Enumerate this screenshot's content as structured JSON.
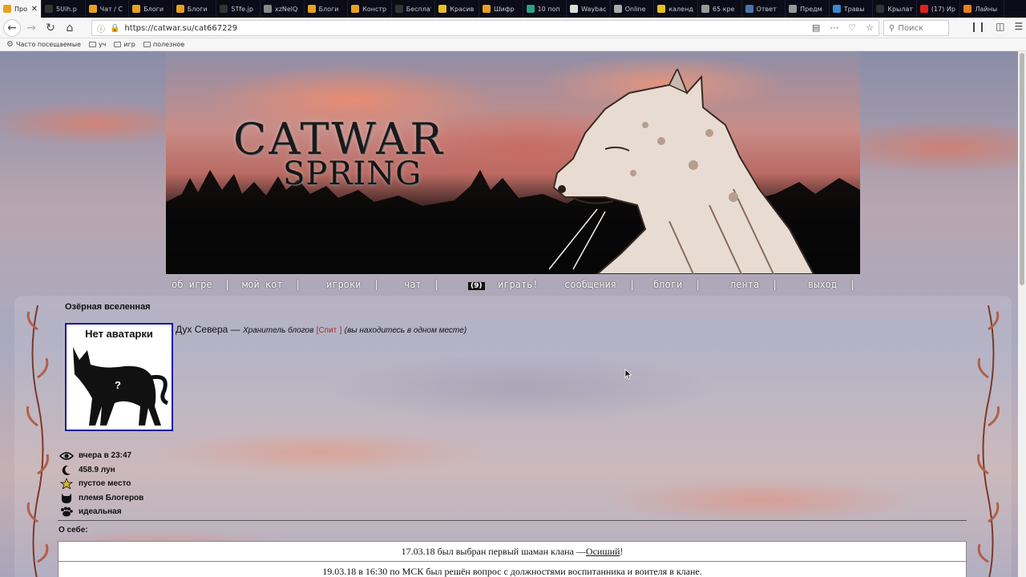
{
  "browser": {
    "tabs": [
      {
        "label": "Про",
        "color": "#e8a020",
        "active": true
      },
      {
        "label": "5Uih.p",
        "color": "#333"
      },
      {
        "label": "Чат / С",
        "color": "#e8a020"
      },
      {
        "label": "Блоги",
        "color": "#e8a020"
      },
      {
        "label": "Блоги",
        "color": "#e8a020"
      },
      {
        "label": "5Tfe.jp",
        "color": "#333"
      },
      {
        "label": "xzNelQ",
        "color": "#888"
      },
      {
        "label": "Блоги",
        "color": "#e8a020"
      },
      {
        "label": "Констр",
        "color": "#e8a020"
      },
      {
        "label": "Бесплатны",
        "color": "#333"
      },
      {
        "label": "Красив",
        "color": "#e8c020"
      },
      {
        "label": "Шифр",
        "color": "#e8a020"
      },
      {
        "label": "10 поп",
        "color": "#2aa088"
      },
      {
        "label": "Waybac",
        "color": "#ddd"
      },
      {
        "label": "Online",
        "color": "#aaa"
      },
      {
        "label": "календ",
        "color": "#e8c020"
      },
      {
        "label": "65 кре",
        "color": "#999"
      },
      {
        "label": "Ответ",
        "color": "#4a76a8"
      },
      {
        "label": "Предм",
        "color": "#999"
      },
      {
        "label": "Травы",
        "color": "#3a8acf"
      },
      {
        "label": "Крылат",
        "color": "#333"
      },
      {
        "label": "(17) Ир",
        "color": "#e02020"
      },
      {
        "label": "Лайны",
        "color": "#e88020"
      }
    ],
    "url": "https://catwar.su/cat667229",
    "search_placeholder": "Поиск",
    "bookmarks": [
      "Часто посещаемые",
      "уч",
      "игр",
      "полезное"
    ]
  },
  "site": {
    "logo_line1": "CATWAR",
    "logo_line2": "SPRING",
    "menu": [
      {
        "label": "об игре"
      },
      {
        "label": "мой кот"
      },
      {
        "label": "игроки"
      },
      {
        "label": "чат"
      },
      {
        "label": "играть!"
      },
      {
        "label": "сообщения"
      },
      {
        "label": "блоги"
      },
      {
        "label": "лента"
      },
      {
        "label": "выход"
      }
    ],
    "separator": "|",
    "play_badge": "(9)"
  },
  "profile": {
    "universe": "Озёрная вселенная",
    "avatar_text": "Нет аватарки",
    "avatar_question": "?",
    "name": "Дух Севера",
    "dash": "—",
    "role": "Хранитель блогов",
    "status_open": "[",
    "status": "Спит",
    "status_close": "]",
    "location_note": "(вы находитесь в одном месте)",
    "stats": [
      {
        "icon": "eye-icon",
        "text": "вчера в 23:47"
      },
      {
        "icon": "moon-icon",
        "text": "458.9 лун"
      },
      {
        "icon": "star-icon",
        "text": "пустое место"
      },
      {
        "icon": "cat-head-icon",
        "text": "племя Блогеров"
      },
      {
        "icon": "paw-icon",
        "text": "идеальная"
      }
    ],
    "about_label": "О себе:",
    "news": [
      {
        "prefix": "17.03.18 был выбран первый шаман клана — ",
        "link": "Осиший",
        "suffix": "!"
      },
      {
        "prefix": "19.03.18 в 16:30 по МСК был решён вопрос с должностями воспитанника и воителя в клане.",
        "link": "",
        "suffix": ""
      }
    ]
  }
}
